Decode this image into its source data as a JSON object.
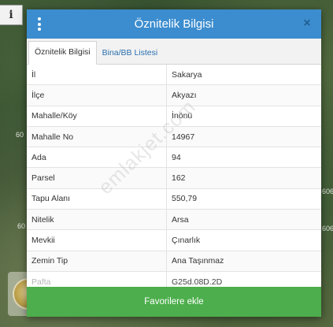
{
  "map": {
    "info_button_label": "i",
    "edge_labels": [
      "60",
      "60",
      "606",
      "606"
    ]
  },
  "modal": {
    "title": "Öznitelik Bilgisi",
    "close_label": "×",
    "tabs": [
      {
        "label": "Öznitelik Bilgisi",
        "active": true
      },
      {
        "label": "Bina/BB Listesi",
        "active": false
      }
    ],
    "rows": [
      {
        "label": "İl",
        "value": "Sakarya"
      },
      {
        "label": "İlçe",
        "value": "Akyazı"
      },
      {
        "label": "Mahalle/Köy",
        "value": "İnönü"
      },
      {
        "label": "Mahalle No",
        "value": "14967"
      },
      {
        "label": "Ada",
        "value": "94"
      },
      {
        "label": "Parsel",
        "value": "162"
      },
      {
        "label": "Tapu Alanı",
        "value": "550,79"
      },
      {
        "label": "Nitelik",
        "value": "Arsa"
      },
      {
        "label": "Mevkii",
        "value": "Çınarlık"
      },
      {
        "label": "Zemin Tip",
        "value": "Ana Taşınmaz"
      },
      {
        "label": "Pafta",
        "value": "G25d.08D.2D"
      }
    ],
    "watermark": "emlakjet.com",
    "favorite_button_label": "Favorilere ekle"
  },
  "colors": {
    "header": "#3c8dcf",
    "favorite_button": "#4cae4c",
    "tab_link": "#2a6fb0"
  }
}
